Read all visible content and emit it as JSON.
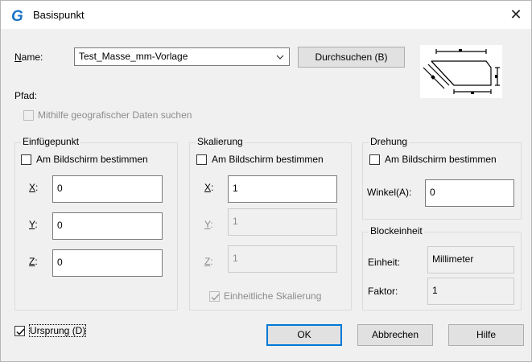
{
  "window": {
    "title": "Basispunkt",
    "close_glyph": "✕"
  },
  "name": {
    "label": "Name:",
    "value": "Test_Masse_mm-Vorlage",
    "browse_label": "Durchsuchen (B)"
  },
  "path": {
    "label": "Pfad:"
  },
  "geo": {
    "label": "Mithilfe geografischer Daten suchen",
    "checked": false
  },
  "insert": {
    "legend": "Einfügepunkt",
    "on_screen_label": "Am Bildschirm bestimmen",
    "x_label": "X:",
    "x_value": "0",
    "y_label": "Y:",
    "y_value": "0",
    "z_label": "Z:",
    "z_value": "0"
  },
  "scale": {
    "legend": "Skalierung",
    "on_screen_label": "Am Bildschirm bestimmen",
    "x_label": "X:",
    "x_value": "1",
    "y_label": "Y:",
    "y_value": "1",
    "z_label": "Z:",
    "z_value": "1",
    "uniform_label": "Einheitliche Skalierung"
  },
  "rotation": {
    "legend": "Drehung",
    "on_screen_label": "Am Bildschirm bestimmen",
    "angle_label": "Winkel(A):",
    "angle_value": "0"
  },
  "block_unit": {
    "legend": "Blockeinheit",
    "unit_label": "Einheit:",
    "unit_value": "Millimeter",
    "factor_label": "Faktor:",
    "factor_value": "1"
  },
  "origin": {
    "label": "Ursprung (D)",
    "checked": true
  },
  "buttons": {
    "ok": "OK",
    "cancel": "Abbrechen",
    "help": "Hilfe"
  },
  "colors": {
    "accent": "#0078d7",
    "title_icon": "#1a73c8"
  },
  "icons": {
    "app": "g-logo-icon",
    "close": "close-icon",
    "dropdown": "chevron-down-icon",
    "check": "checkmark-icon"
  }
}
